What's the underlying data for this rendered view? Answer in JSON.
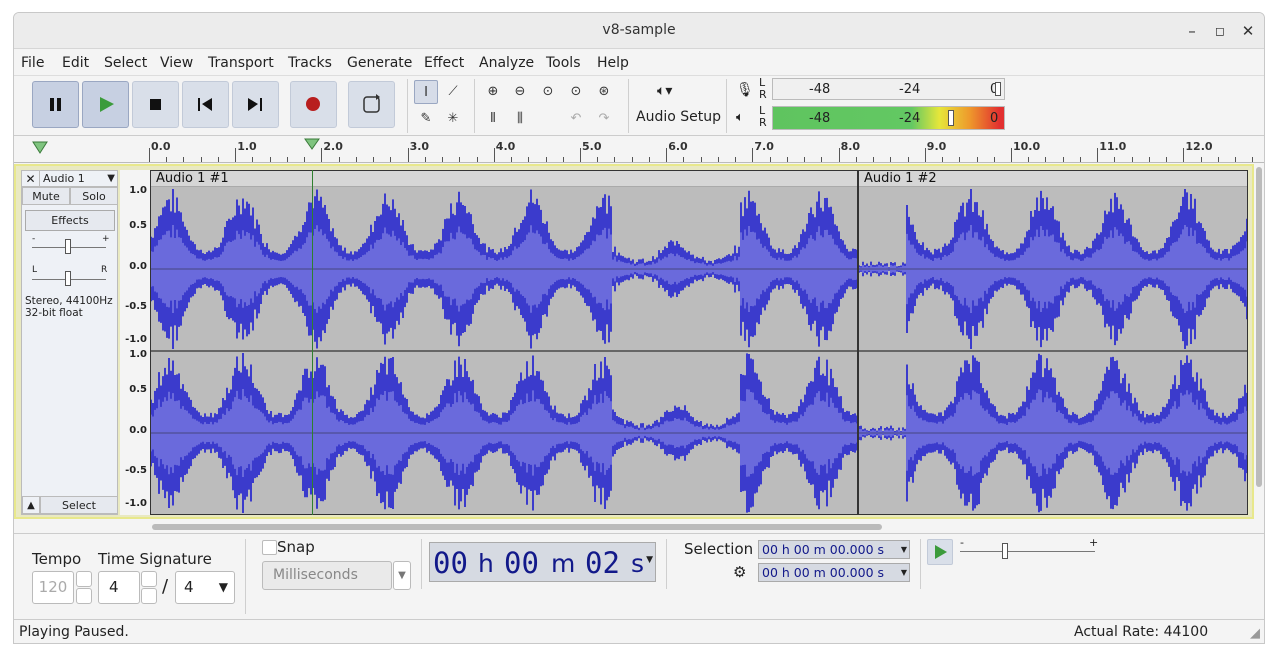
{
  "window": {
    "title": "v8-sample"
  },
  "menu": [
    "File",
    "Edit",
    "Select",
    "View",
    "Transport",
    "Tracks",
    "Generate",
    "Effect",
    "Analyze",
    "Tools",
    "Help"
  ],
  "toolbar": {
    "audio_setup_label": "Audio Setup",
    "meter_ticks": [
      "-48",
      "-24",
      "0"
    ],
    "meter_lr": [
      "L",
      "R"
    ]
  },
  "ruler": {
    "labels": [
      "0.0",
      "1.0",
      "2.0",
      "3.0",
      "4.0",
      "5.0",
      "6.0",
      "7.0",
      "8.0",
      "9.0",
      "10.0",
      "11.0",
      "12.0"
    ]
  },
  "track": {
    "name": "Audio 1",
    "mute": "Mute",
    "solo": "Solo",
    "effects": "Effects",
    "info_line1": "Stereo, 44100Hz",
    "info_line2": "32-bit float",
    "select": "Select",
    "gain_minus": "-",
    "gain_plus": "+",
    "pan_l": "L",
    "pan_r": "R"
  },
  "scale": [
    "1.0",
    "0.5",
    "0.0",
    "-0.5",
    "-1.0",
    "1.0",
    "0.5",
    "0.0",
    "-0.5",
    "-1.0"
  ],
  "clips": [
    {
      "name": "Audio 1 #1"
    },
    {
      "name": "Audio 1 #2"
    }
  ],
  "bottom": {
    "tempo_label": "Tempo",
    "tempo_value": "120",
    "time_signature_label": "Time Signature",
    "ts_num": "4",
    "ts_slash": "/",
    "ts_den": "4",
    "snap_label": "Snap",
    "snap_unit": "Milliseconds",
    "time_h": "00",
    "time_h_unit": "h",
    "time_m": "00",
    "time_m_unit": "m",
    "time_s": "02",
    "time_s_unit": "s",
    "selection_label": "Selection",
    "sel_start": "00 h 00 m 00.000 s",
    "sel_end": "00 h 00 m 00.000 s",
    "speed_minus": "-",
    "speed_plus": "+"
  },
  "status": {
    "left": "Playing Paused.",
    "right": "Actual Rate: 44100"
  },
  "colors": {
    "wave": "#3b3bcc",
    "wave_light": "#6a6adc",
    "clip_bg": "#bcbcbc",
    "track_border": "#e8e88c"
  }
}
